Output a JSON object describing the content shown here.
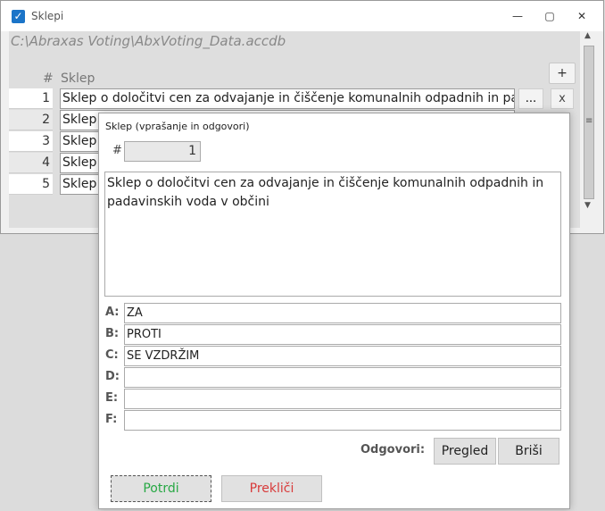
{
  "window": {
    "title": "Sklepi",
    "min_glyph": "—",
    "max_glyph": "▢",
    "close_glyph": "✕"
  },
  "main": {
    "db_path": "C:\\Abraxas Voting\\AbxVoting_Data.accdb",
    "col_num": "#",
    "col_sklep": "Sklep",
    "add_label": "+",
    "rows": [
      {
        "num": "1",
        "text": "Sklep o določitvi cen za odvajanje in čiščenje komunalnih odpadnih in padavinskih voda v občini",
        "dots": "...",
        "x": "x"
      },
      {
        "num": "2",
        "text": "Sklep"
      },
      {
        "num": "3",
        "text": "Sklep"
      },
      {
        "num": "4",
        "text": "Sklep"
      },
      {
        "num": "5",
        "text": "Sklep"
      }
    ]
  },
  "dialog": {
    "title": "Sklep (vprašanje in odgovori)",
    "hash_label": "#",
    "number": "1",
    "text": "Sklep o določitvi cen za odvajanje in čiščenje komunalnih odpadnih in padavinskih voda v občini",
    "answers": [
      {
        "label": "A:",
        "value": "ZA"
      },
      {
        "label": "B:",
        "value": "PROTI"
      },
      {
        "label": "C:",
        "value": "SE VZDRŽIM"
      },
      {
        "label": "D:",
        "value": ""
      },
      {
        "label": "E:",
        "value": ""
      },
      {
        "label": "F:",
        "value": ""
      }
    ],
    "odgovori_label": "Odgovori:",
    "pregled_label": "Pregled",
    "brisi_label": "Briši",
    "potrdi_label": "Potrdi",
    "preklici_label": "Prekliči"
  },
  "colors": {
    "accent": "#1b74c8",
    "confirm": "#27a844",
    "cancel": "#d83b3b"
  }
}
